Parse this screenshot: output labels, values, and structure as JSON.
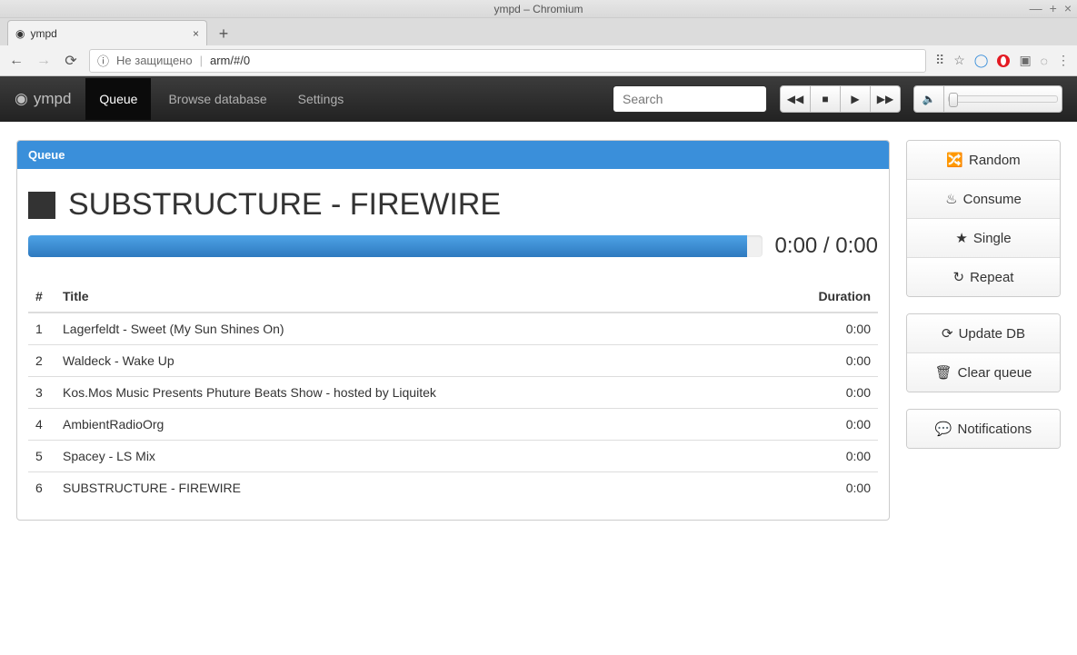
{
  "window": {
    "title": "ympd – Chromium"
  },
  "browser": {
    "tab_title": "ympd",
    "insecure_label": "Не защищено",
    "address": "arm/#/0"
  },
  "navbar": {
    "brand": "ympd",
    "links": {
      "queue": "Queue",
      "browse": "Browse database",
      "settings": "Settings"
    },
    "search_placeholder": "Search"
  },
  "panel": {
    "heading": "Queue",
    "now_playing": "SUBSTRUCTURE - FIREWIRE",
    "time_current": "0:00",
    "time_total": "0:00"
  },
  "columns": {
    "num": "#",
    "title": "Title",
    "duration": "Duration"
  },
  "queue": [
    {
      "n": "1",
      "title": "Lagerfeldt - Sweet (My Sun Shines On)",
      "dur": "0:00"
    },
    {
      "n": "2",
      "title": "Waldeck - Wake Up",
      "dur": "0:00"
    },
    {
      "n": "3",
      "title": "Kos.Mos Music Presents Phuture Beats Show - hosted by Liquitek",
      "dur": "0:00"
    },
    {
      "n": "4",
      "title": "AmbientRadioOrg",
      "dur": "0:00"
    },
    {
      "n": "5",
      "title": "Spacey - LS Mix",
      "dur": "0:00"
    },
    {
      "n": "6",
      "title": "SUBSTRUCTURE - FIREWIRE",
      "dur": "0:00"
    }
  ],
  "sidebar": {
    "random": "Random",
    "consume": "Consume",
    "single": "Single",
    "repeat": "Repeat",
    "update_db": "Update DB",
    "clear_queue": "Clear queue",
    "notifications": "Notifications"
  }
}
